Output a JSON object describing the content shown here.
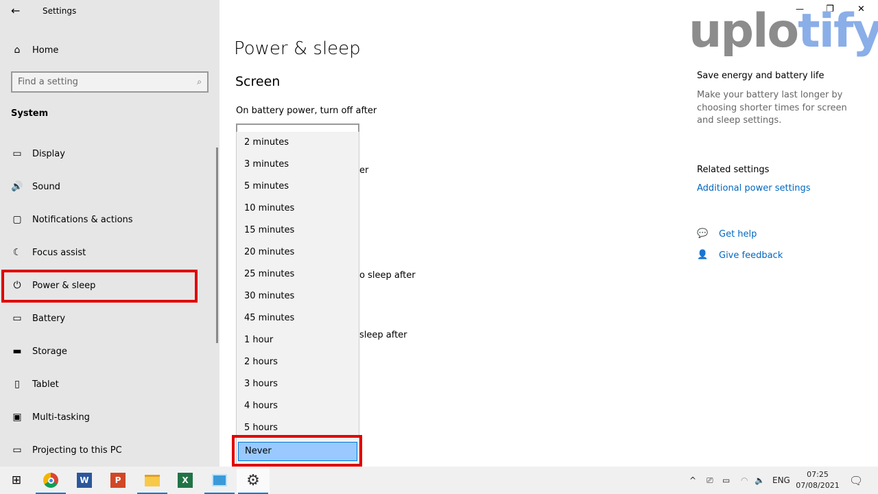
{
  "window": {
    "title": "Settings",
    "minimize": "—",
    "restore": "❐",
    "close": "✕"
  },
  "watermark": "uplotify",
  "sidebar": {
    "home": "Home",
    "search_placeholder": "Find a setting",
    "section": "System",
    "items": [
      {
        "label": "Display",
        "icon": "display-icon"
      },
      {
        "label": "Sound",
        "icon": "sound-icon"
      },
      {
        "label": "Notifications & actions",
        "icon": "notifications-icon"
      },
      {
        "label": "Focus assist",
        "icon": "focus-assist-icon"
      },
      {
        "label": "Power & sleep",
        "icon": "power-icon",
        "selected": true
      },
      {
        "label": "Battery",
        "icon": "battery-icon"
      },
      {
        "label": "Storage",
        "icon": "storage-icon"
      },
      {
        "label": "Tablet",
        "icon": "tablet-icon"
      },
      {
        "label": "Multi-tasking",
        "icon": "multitasking-icon"
      },
      {
        "label": "Projecting to this PC",
        "icon": "projecting-icon"
      }
    ]
  },
  "main": {
    "title": "Power & sleep",
    "screen_heading": "Screen",
    "battery_label": "On battery power, turn off after",
    "hidden_fragments": [
      "er",
      "o sleep after",
      "sleep after"
    ],
    "dropdown_options": [
      "2 minutes",
      "3 minutes",
      "5 minutes",
      "10 minutes",
      "15 minutes",
      "20 minutes",
      "25 minutes",
      "30 minutes",
      "45 minutes",
      "1 hour",
      "2 hours",
      "3 hours",
      "4 hours",
      "5 hours",
      "Never"
    ],
    "selected_option": "Never"
  },
  "aside": {
    "save_heading": "Save energy and battery life",
    "save_text": "Make your battery last longer by choosing shorter times for screen and sleep settings.",
    "related_heading": "Related settings",
    "additional_power": "Additional power settings",
    "get_help": "Get help",
    "give_feedback": "Give feedback"
  },
  "taskbar": {
    "apps": [
      "Start",
      "Chrome",
      "Word",
      "PowerPoint",
      "File Explorer",
      "Excel",
      "Control Panel",
      "Settings"
    ],
    "language": "ENG",
    "time": "07:25",
    "date": "07/08/2021"
  },
  "colors": {
    "accent": "#0078d7",
    "highlight": "#99c9ff",
    "annotation": "#e00000",
    "link": "#0067c0"
  }
}
